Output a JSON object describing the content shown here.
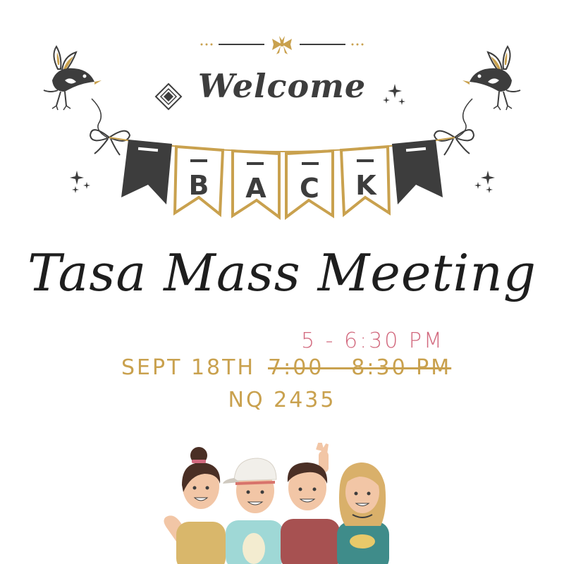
{
  "heading": {
    "welcome": "Welcome",
    "banner_letters": [
      "B",
      "A",
      "C",
      "K"
    ]
  },
  "event": {
    "title": "Tasa Mass Meeting",
    "new_time": "5 - 6:30 PM",
    "date": "SEPT 18TH",
    "old_time": "7:00 - 8:30 PM",
    "location": "NQ 2435"
  },
  "colors": {
    "dark": "#3d3d3d",
    "gold": "#c9a14e",
    "pink": "#d2697e"
  },
  "icons": [
    "bird-icon",
    "bow-icon",
    "sparkle-icon",
    "diamond-icon",
    "ribbon-ornament-icon"
  ]
}
